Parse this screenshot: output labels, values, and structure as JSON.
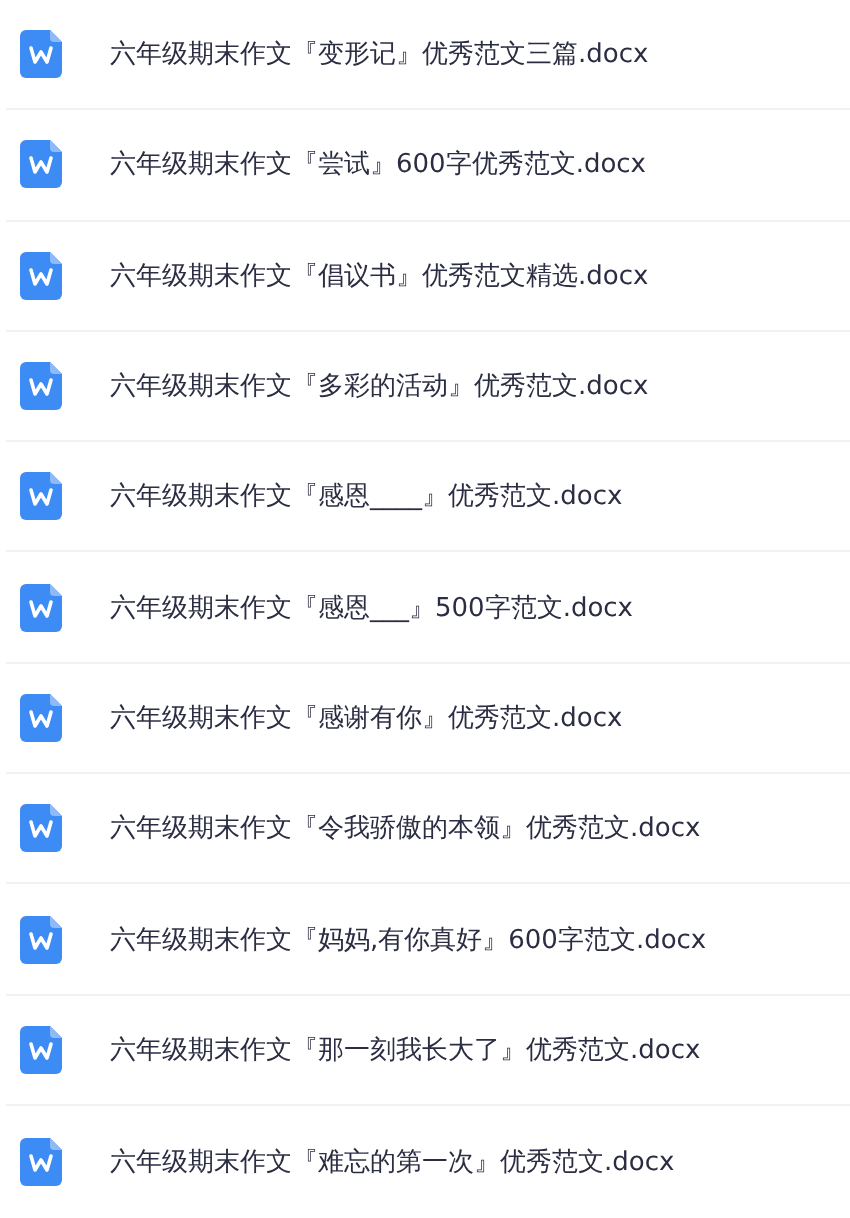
{
  "files": [
    {
      "name": "六年级期末作文『变形记』优秀范文三篇.docx"
    },
    {
      "name": "六年级期末作文『尝试』600字优秀范文.docx"
    },
    {
      "name": "六年级期末作文『倡议书』优秀范文精选.docx"
    },
    {
      "name": "六年级期末作文『多彩的活动』优秀范文.docx"
    },
    {
      "name": "六年级期末作文『感恩____』优秀范文.docx"
    },
    {
      "name": "六年级期末作文『感恩___』500字范文.docx"
    },
    {
      "name": "六年级期末作文『感谢有你』优秀范文.docx"
    },
    {
      "name": "六年级期末作文『令我骄傲的本领』优秀范文.docx"
    },
    {
      "name": "六年级期末作文『妈妈,有你真好』600字范文.docx"
    },
    {
      "name": "六年级期末作文『那一刻我长大了』优秀范文.docx"
    },
    {
      "name": "六年级期末作文『难忘的第一次』优秀范文.docx"
    }
  ]
}
